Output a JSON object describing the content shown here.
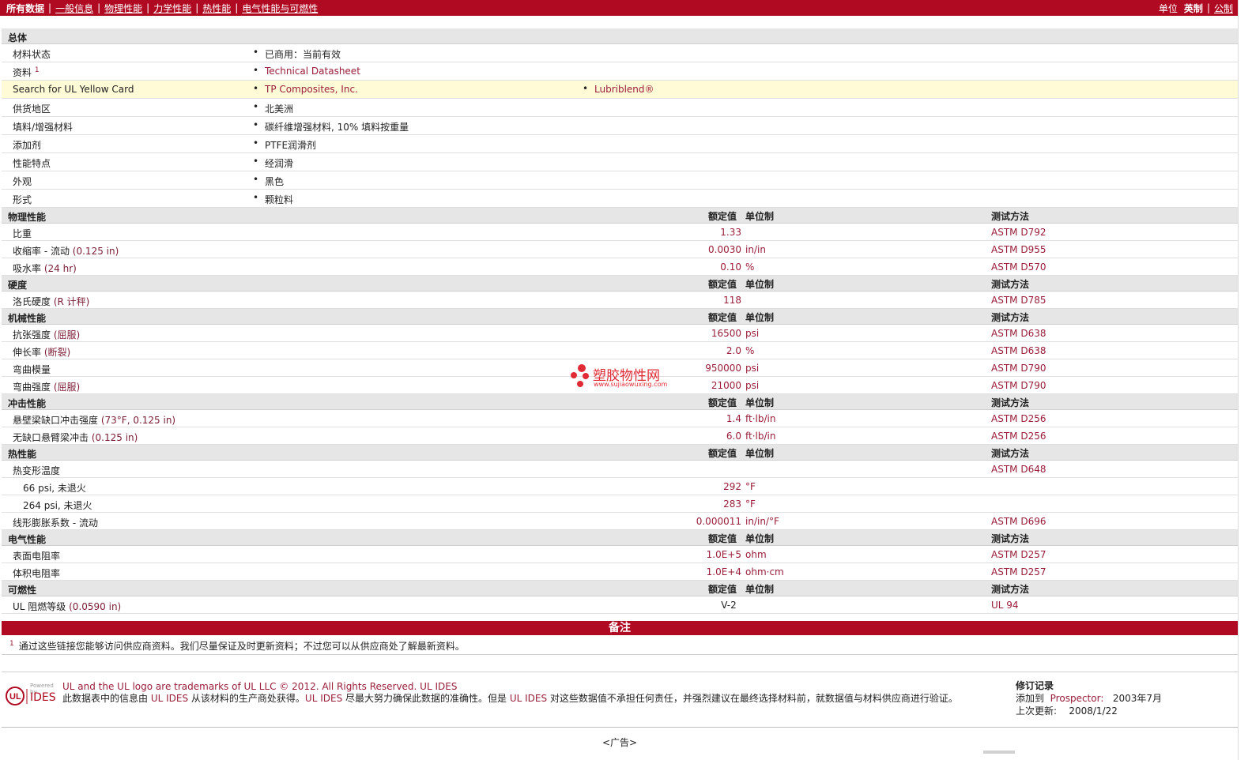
{
  "nav": {
    "items": [
      "所有数据",
      "一般信息",
      "物理性能",
      "力学性能",
      "热性能",
      "电气性能与可燃性"
    ],
    "units_label": "单位",
    "unit_english": "英制",
    "unit_metric": "公制"
  },
  "general": {
    "title": "总体",
    "rows": [
      {
        "label": "材料状态",
        "sup": "",
        "v1": "已商用：当前有效",
        "v2": ""
      },
      {
        "label": "资料",
        "sup": "1",
        "v1": "Technical Datasheet",
        "v2": ""
      },
      {
        "label": "Search for UL Yellow Card",
        "sup": "",
        "v1": "TP Composites, Inc.",
        "v2": "Lubriblend®"
      },
      {
        "label": "供货地区",
        "sup": "",
        "v1": "北美洲",
        "v2": ""
      },
      {
        "label": "填料/增强材料",
        "sup": "",
        "v1": "碳纤维增强材料, 10% 填料按重量",
        "v2": ""
      },
      {
        "label": "添加剂",
        "sup": "",
        "v1": "PTFE润滑剂",
        "v2": ""
      },
      {
        "label": "性能特点",
        "sup": "",
        "v1": "经润滑",
        "v2": ""
      },
      {
        "label": "外观",
        "sup": "",
        "v1": "黑色",
        "v2": ""
      },
      {
        "label": "形式",
        "sup": "",
        "v1": "颗粒料",
        "v2": ""
      }
    ]
  },
  "col_headers": {
    "value": "额定值",
    "unit": "单位制",
    "method": "测试方法"
  },
  "sections": [
    {
      "title": "物理性能",
      "rows": [
        {
          "label": "比重",
          "cond": "",
          "value": "1.33",
          "unit": "",
          "method": "ASTM D792"
        },
        {
          "label": "收缩率 - 流动",
          "cond": "(0.125 in)",
          "value": "0.0030",
          "unit": "in/in",
          "method": "ASTM D955"
        },
        {
          "label": "吸水率",
          "cond": "(24 hr)",
          "value": "0.10",
          "unit": "%",
          "method": "ASTM D570"
        }
      ]
    },
    {
      "title": "硬度",
      "rows": [
        {
          "label": "洛氏硬度",
          "cond": "(R 计秤)",
          "value": "118",
          "unit": "",
          "method": "ASTM D785"
        }
      ]
    },
    {
      "title": "机械性能",
      "rows": [
        {
          "label": "抗张强度",
          "cond": "(屈服)",
          "value": "16500",
          "unit": "psi",
          "method": "ASTM D638"
        },
        {
          "label": "伸长率",
          "cond": "(断裂)",
          "value": "2.0",
          "unit": "%",
          "method": "ASTM D638"
        },
        {
          "label": "弯曲模量",
          "cond": "",
          "value": "950000",
          "unit": "psi",
          "method": "ASTM D790"
        },
        {
          "label": "弯曲强度",
          "cond": "(屈服)",
          "value": "21000",
          "unit": "psi",
          "method": "ASTM D790"
        }
      ]
    },
    {
      "title": "冲击性能",
      "rows": [
        {
          "label": "悬壁梁缺口冲击强度",
          "cond": "(73°F, 0.125 in)",
          "value": "1.4",
          "unit": "ft·lb/in",
          "method": "ASTM D256"
        },
        {
          "label": "无缺口悬臂梁冲击",
          "cond": "(0.125 in)",
          "value": "6.0",
          "unit": "ft·lb/in",
          "method": "ASTM D256"
        }
      ]
    },
    {
      "title": "热性能",
      "rows": [
        {
          "label": "热变形温度",
          "cond": "",
          "value": "",
          "unit": "",
          "method": "ASTM D648"
        },
        {
          "label": "66 psi, 未退火",
          "cond": "",
          "value": "292",
          "unit": "°F",
          "method": "",
          "sub": true
        },
        {
          "label": "264 psi, 未退火",
          "cond": "",
          "value": "283",
          "unit": "°F",
          "method": "",
          "sub": true
        },
        {
          "label": "线形膨胀系数 - 流动",
          "cond": "",
          "value": "0.000011",
          "unit": "in/in/°F",
          "method": "ASTM D696"
        }
      ]
    },
    {
      "title": "电气性能",
      "rows": [
        {
          "label": "表面电阻率",
          "cond": "",
          "value": "1.0E+5",
          "unit": "ohm",
          "method": "ASTM D257"
        },
        {
          "label": "体积电阻率",
          "cond": "",
          "value": "1.0E+4",
          "unit": "ohm·cm",
          "method": "ASTM D257"
        }
      ]
    },
    {
      "title": "可燃性",
      "rows": [
        {
          "label": "UL 阻燃等级",
          "cond": "(0.0590 in)",
          "value": "V-2",
          "unit": "",
          "method": "UL 94",
          "center": true
        }
      ]
    }
  ],
  "notes": {
    "title": "备注",
    "items": [
      {
        "num": "1",
        "text": "通过这些链接您能够访问供应商资料。我们尽量保证及时更新资料；不过您可以从供应商处了解最新资料。"
      }
    ]
  },
  "footer": {
    "logo_powered": "Powered by",
    "logo_text": "IDES",
    "disclaimer1": "UL and the UL logo are trademarks of UL LLC © 2012. All Rights Reserved. UL IDES",
    "disc_a": "此数据表中的信息由 ",
    "disc_b": "UL IDES",
    "disc_c": " 从该材料的生产商处获得。",
    "disc_d": "UL IDES",
    "disc_e": " 尽最大努力确保此数据的准确性。但是 ",
    "disc_f": "UL IDES",
    "disc_g": " 对这些数据值不承担任何责任，并强烈建议在最终选择材料前，就数据值与材料供应商进行验证。",
    "rev_title": "修订记录",
    "rev_added_label": "添加到",
    "rev_added_target": "Prospector:",
    "rev_added_date": "2003年7月",
    "rev_updated_label": "上次更新:",
    "rev_updated_date": "2008/1/22"
  },
  "ad": "<广告>",
  "watermark": {
    "title": "塑胶物性网",
    "url": "www.sujiaowuxing.com"
  },
  "colors": {
    "brand_red": "#b00a22",
    "link": "#9a1d3a",
    "section_bg": "#e6e6e6",
    "highlight_bg": "#fffbd6"
  }
}
